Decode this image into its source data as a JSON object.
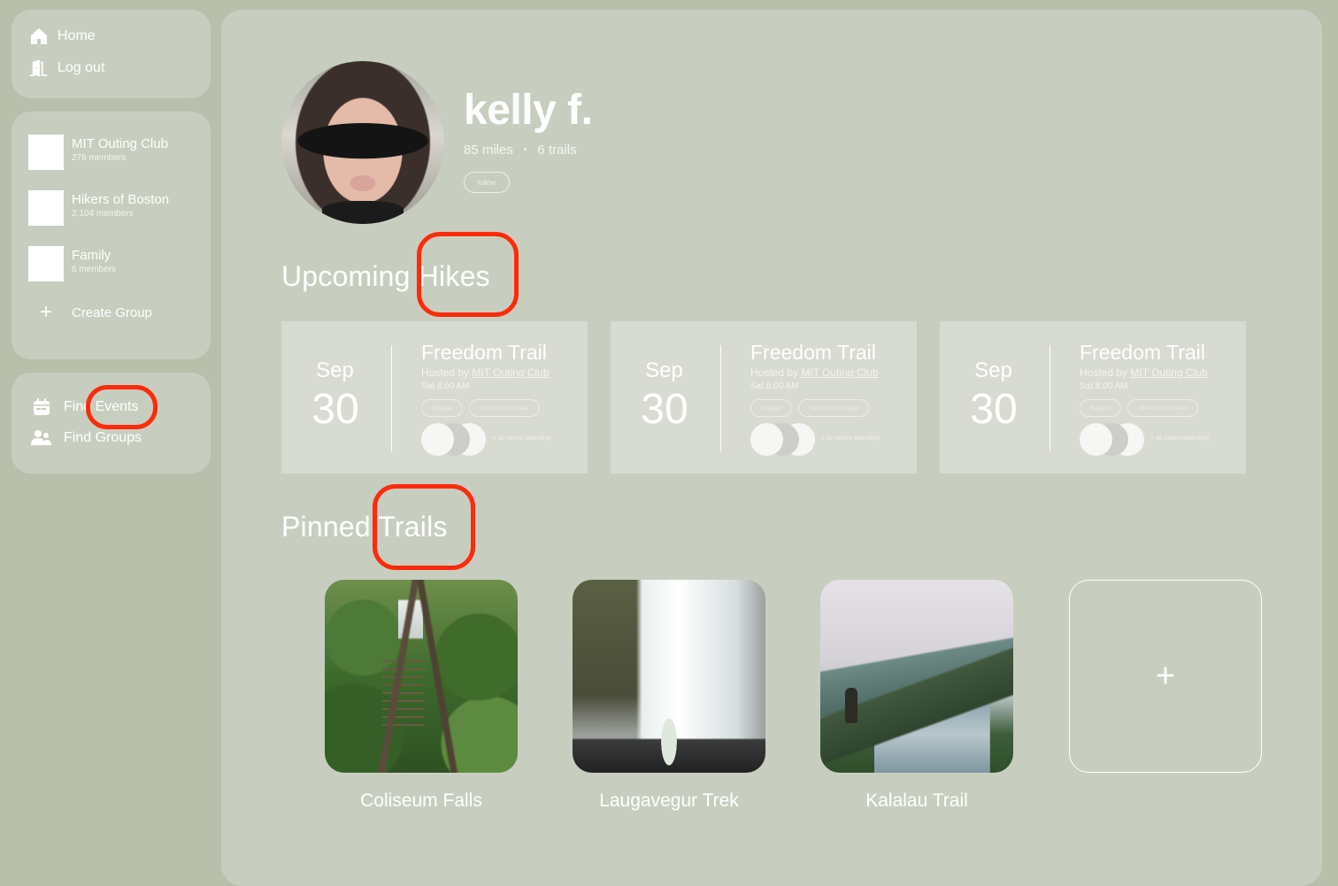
{
  "nav": {
    "items": [
      {
        "label": "Home",
        "icon": "home-icon"
      },
      {
        "label": "Log out",
        "icon": "door-exit-icon"
      }
    ]
  },
  "groups": {
    "items": [
      {
        "name": "MIT Outing Club",
        "members": "276 members"
      },
      {
        "name": "Hikers of Boston",
        "members": "2,104 members"
      },
      {
        "name": "Family",
        "members": "6 members"
      }
    ],
    "create_label": "Create Group"
  },
  "find": {
    "items": [
      {
        "label": "Find Events",
        "icon": "calendar-icon"
      },
      {
        "label": "Find Groups",
        "icon": "users-icon"
      }
    ]
  },
  "profile": {
    "name": "kelly f.",
    "miles": "85 miles",
    "separator": "•",
    "trails": "6 trails",
    "follow_label": "follow"
  },
  "upcoming": {
    "title": "Upcoming Hikes",
    "events": [
      {
        "month": "Sep",
        "day": "30",
        "title": "Freedom Trail",
        "hosted_prefix": "Hosted by",
        "host": "MIT Outing Club",
        "time": "Sat 8:00 AM",
        "register_label": "Register",
        "details_label": "View Event Details",
        "attending": "+ 36 others attending"
      },
      {
        "month": "Sep",
        "day": "30",
        "title": "Freedom Trail",
        "hosted_prefix": "Hosted by",
        "host": "MIT Outing Club",
        "time": "Sat 8:00 AM",
        "register_label": "Register",
        "details_label": "View Event Details",
        "attending": "+ 36 others attending"
      },
      {
        "month": "Sep",
        "day": "30",
        "title": "Freedom Trail",
        "hosted_prefix": "Hosted by",
        "host": "MIT Outing Club",
        "time": "Sat 8:00 AM",
        "register_label": "Register",
        "details_label": "View Event Details",
        "attending": "+ 36 others attending"
      }
    ]
  },
  "pinned": {
    "title": "Pinned Trails",
    "trails": [
      {
        "name": "Coliseum Falls"
      },
      {
        "name": "Laugavegur Trek"
      },
      {
        "name": "Kalalau Trail"
      }
    ],
    "add_label": "+"
  },
  "colors": {
    "background": "#b8c0ab",
    "panel": "#c8cebf",
    "card": "#d8dbd1",
    "text": "#ffffff",
    "highlight": "#ff2a0a"
  }
}
